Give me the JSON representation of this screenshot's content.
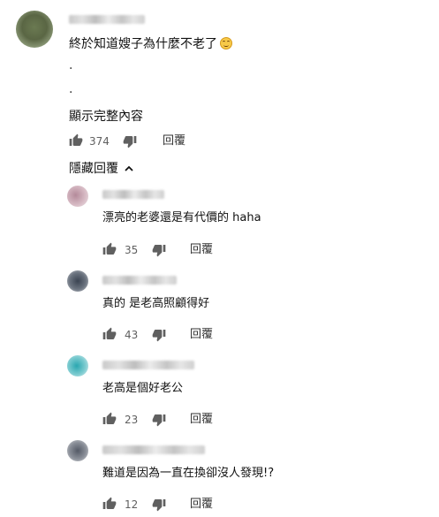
{
  "main_comment": {
    "text": "終於知道嫂子為什麼不老了",
    "emoji": "smiling-face",
    "dot1": ".",
    "dot2": ".",
    "show_full": "顯示完整內容",
    "likes": "374",
    "reply_label": "回覆"
  },
  "hide_replies": {
    "label": "隱藏回覆",
    "icon": "chevron-up-icon"
  },
  "replies": [
    {
      "text": "漂亮的老婆還是有代價的 haha",
      "likes": "35",
      "reply_label": "回覆"
    },
    {
      "text": "真的 是老高照顧得好",
      "likes": "43",
      "reply_label": "回覆"
    },
    {
      "text": "老高是個好老公",
      "likes": "23",
      "reply_label": "回覆"
    },
    {
      "text": "難道是因為一直在換卻沒人發現!?",
      "likes": "12",
      "reply_label": "回覆"
    }
  ]
}
